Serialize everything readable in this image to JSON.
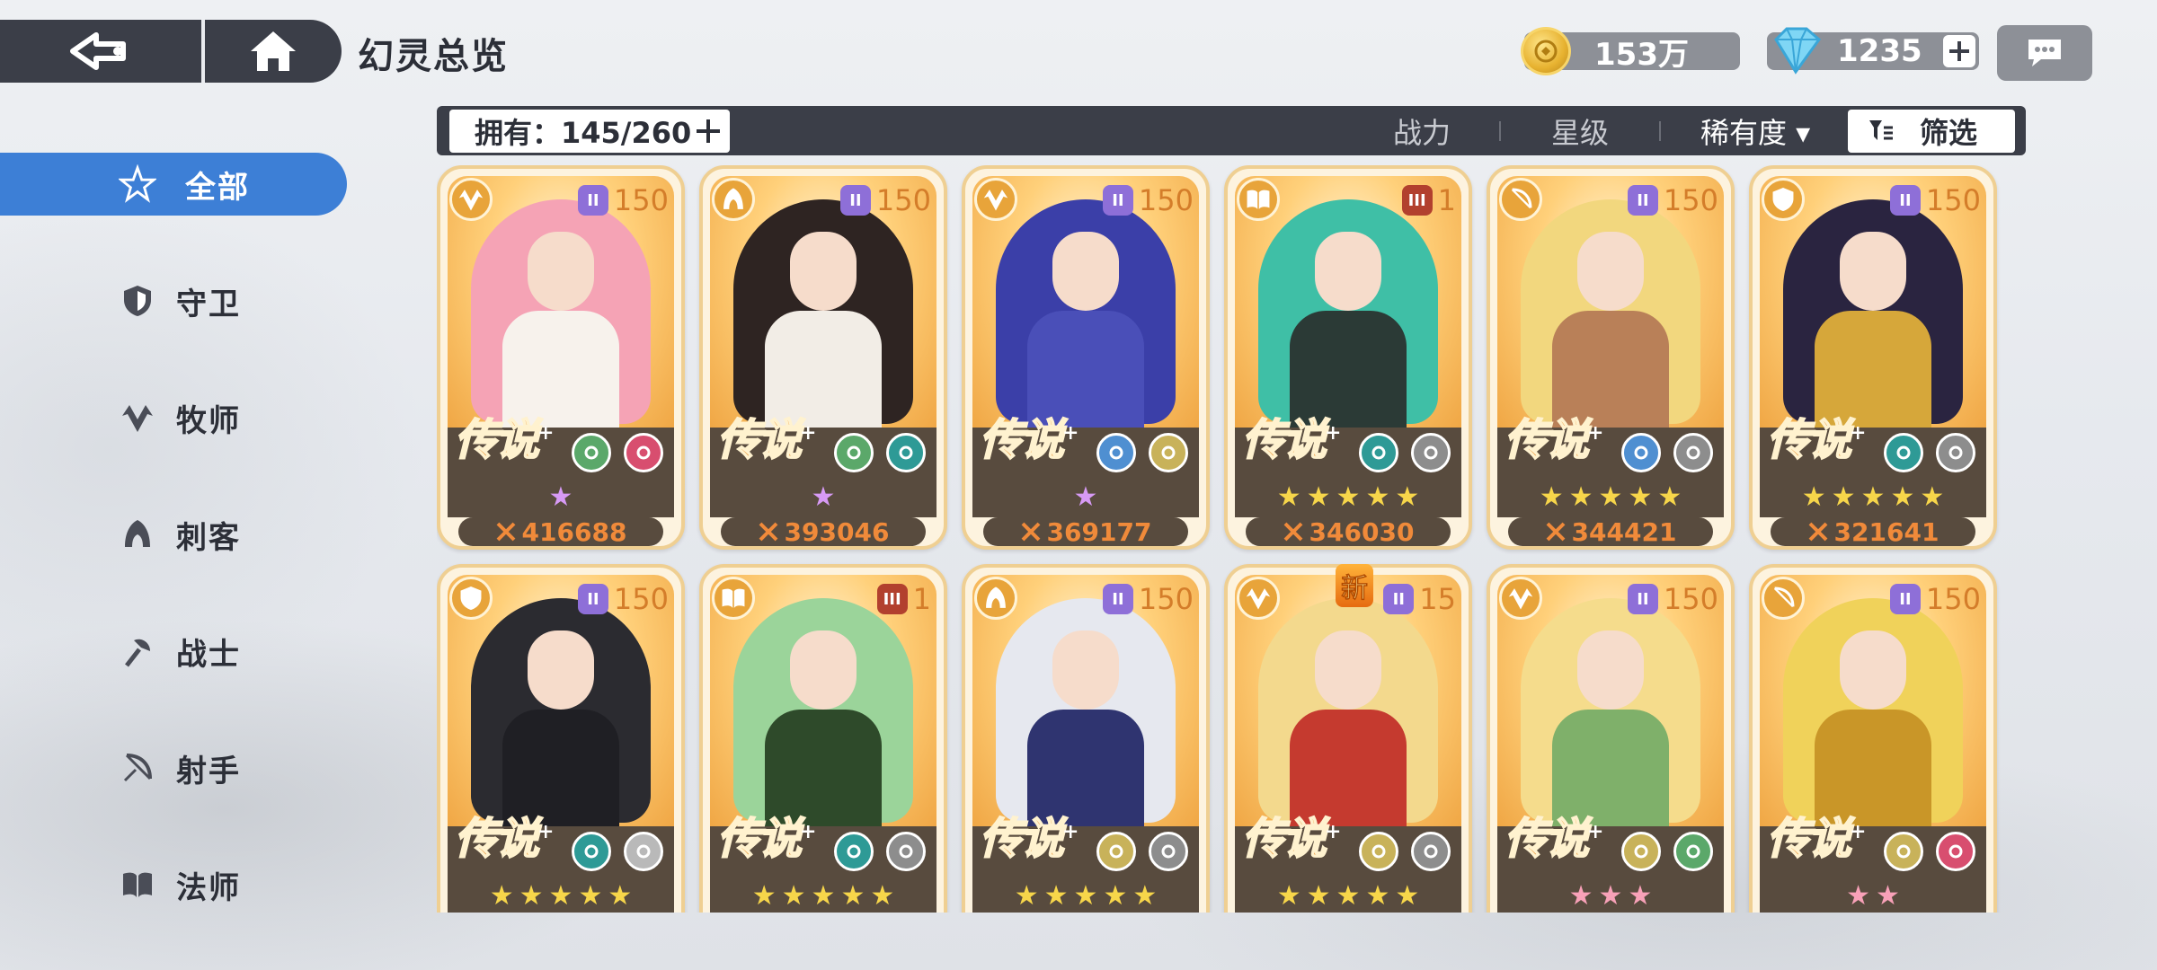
{
  "header": {
    "title": "幻灵总览",
    "gold": "153万",
    "gems": "1235"
  },
  "sidebar": {
    "items": [
      {
        "label": "全部",
        "icon": "all-star-icon",
        "active": true
      },
      {
        "label": "守卫",
        "icon": "shield-icon",
        "active": false
      },
      {
        "label": "牧师",
        "icon": "wing-leaf-icon",
        "active": false
      },
      {
        "label": "刺客",
        "icon": "assassin-hood-icon",
        "active": false
      },
      {
        "label": "战士",
        "icon": "axe-icon",
        "active": false
      },
      {
        "label": "射手",
        "icon": "bow-icon",
        "active": false
      },
      {
        "label": "法师",
        "icon": "book-icon",
        "active": false
      }
    ]
  },
  "filter_bar": {
    "owned": "拥有：145/260",
    "sort_power": "战力",
    "sort_star": "星级",
    "sort_rarity": "稀有度 ▾",
    "filter": "筛选"
  },
  "cards": [
    {
      "class_icon": "wing-leaf-icon",
      "tier": "II",
      "tier_color": "purple",
      "level": "150",
      "rarity": "传说",
      "elements": [
        "leaf-element-icon",
        "spiral-element-icon"
      ],
      "element_colors": [
        "#5ba86a",
        "#d84e6f"
      ],
      "stars": 1,
      "star_color": "purple",
      "power": "416688",
      "theme": {
        "hair": "#f5a3b5",
        "body": "#f7f2ec"
      }
    },
    {
      "class_icon": "assassin-hood-icon",
      "tier": "II",
      "tier_color": "purple",
      "level": "150",
      "rarity": "传说",
      "elements": [
        "leaf-element-icon",
        "infinity-element-icon"
      ],
      "element_colors": [
        "#5ba86a",
        "#2e9a96"
      ],
      "stars": 1,
      "star_color": "purple",
      "power": "393046",
      "theme": {
        "hair": "#2e2422",
        "body": "#f2ede6"
      }
    },
    {
      "class_icon": "wing-leaf-icon",
      "tier": "II",
      "tier_color": "purple",
      "level": "150",
      "rarity": "传说",
      "elements": [
        "star-element-icon",
        "wing-element-icon"
      ],
      "element_colors": [
        "#4f8fd1",
        "#c8b25a"
      ],
      "stars": 1,
      "star_color": "purple",
      "power": "369177",
      "theme": {
        "hair": "#3b3fa8",
        "body": "#4a4fb8"
      }
    },
    {
      "class_icon": "book-icon",
      "tier": "III",
      "tier_color": "red",
      "level": "1",
      "rarity": "传说",
      "elements": [
        "infinity-element-icon",
        "diamond-element-icon"
      ],
      "element_colors": [
        "#2e9a96",
        "#8d8d8d"
      ],
      "stars": 5,
      "star_color": "gold",
      "power": "346030",
      "theme": {
        "hair": "#3fbfa6",
        "body": "#2b3a36"
      }
    },
    {
      "class_icon": "bow-icon",
      "tier": "II",
      "tier_color": "purple",
      "level": "150",
      "rarity": "传说",
      "elements": [
        "star-element-icon",
        "spiral-element-icon"
      ],
      "element_colors": [
        "#4f8fd1",
        "#8d8d8d"
      ],
      "stars": 5,
      "star_color": "gold",
      "power": "344421",
      "theme": {
        "hair": "#f2d77e",
        "body": "#b98058"
      }
    },
    {
      "class_icon": "shield-icon",
      "tier": "II",
      "tier_color": "purple",
      "level": "150",
      "rarity": "传说",
      "elements": [
        "infinity-element-icon",
        "spiral-element-icon"
      ],
      "element_colors": [
        "#2e9a96",
        "#8d8d8d"
      ],
      "stars": 5,
      "star_color": "gold",
      "power": "321641",
      "theme": {
        "hair": "#2a2440",
        "body": "#d6a73a"
      }
    },
    {
      "class_icon": "shield-icon",
      "tier": "II",
      "tier_color": "purple",
      "level": "150",
      "rarity": "传说",
      "elements": [
        "infinity-element-icon",
        "wing-element-icon"
      ],
      "element_colors": [
        "#2e9a96",
        "#b9b9b9"
      ],
      "stars": 5,
      "star_color": "gold",
      "power": "",
      "theme": {
        "hair": "#2b2b30",
        "body": "#1f1f24"
      }
    },
    {
      "class_icon": "book-icon",
      "tier": "III",
      "tier_color": "red",
      "level": "1",
      "rarity": "传说",
      "elements": [
        "infinity-element-icon",
        "spiral-element-icon"
      ],
      "element_colors": [
        "#2e9a96",
        "#8d8d8d"
      ],
      "stars": 5,
      "star_color": "gold",
      "power": "",
      "theme": {
        "hair": "#9bd49a",
        "body": "#2e4a2a"
      }
    },
    {
      "class_icon": "assassin-hood-icon",
      "tier": "II",
      "tier_color": "purple",
      "level": "150",
      "rarity": "传说",
      "elements": [
        "wing-element-icon",
        "diamond-element-icon"
      ],
      "element_colors": [
        "#c8b25a",
        "#8d8d8d"
      ],
      "stars": 5,
      "star_color": "gold",
      "power": "",
      "theme": {
        "hair": "#e6e8ef",
        "body": "#2f3470"
      }
    },
    {
      "class_icon": "wing-leaf-icon",
      "tier": "II",
      "tier_color": "purple",
      "level": "15",
      "rarity": "传说",
      "elements": [
        "wing-element-icon",
        "diamond-element-icon"
      ],
      "element_colors": [
        "#c8b25a",
        "#8d8d8d"
      ],
      "stars": 5,
      "star_color": "gold",
      "power": "",
      "is_new": true,
      "theme": {
        "hair": "#f3d98d",
        "body": "#c53a2f"
      }
    },
    {
      "class_icon": "wing-leaf-icon",
      "tier": "II",
      "tier_color": "purple",
      "level": "150",
      "rarity": "传说",
      "elements": [
        "wing-element-icon",
        "leaf-element-icon"
      ],
      "element_colors": [
        "#c8b25a",
        "#5ba86a"
      ],
      "stars": 3,
      "star_color": "pink",
      "power": "",
      "theme": {
        "hair": "#f5dc8c",
        "body": "#7fb06a"
      }
    },
    {
      "class_icon": "bow-icon",
      "tier": "II",
      "tier_color": "purple",
      "level": "150",
      "rarity": "传说",
      "elements": [
        "wing-element-icon",
        "spiral-element-icon"
      ],
      "element_colors": [
        "#c8b25a",
        "#d84e6f"
      ],
      "stars": 2,
      "star_color": "pink",
      "power": "",
      "theme": {
        "hair": "#f0d25a",
        "body": "#c99628"
      }
    }
  ],
  "new_label": "新",
  "colors": {
    "accent": "#3d7fd6",
    "dark": "#3b3e48",
    "power": "#f08a3a",
    "card_border": "#efcf92"
  }
}
